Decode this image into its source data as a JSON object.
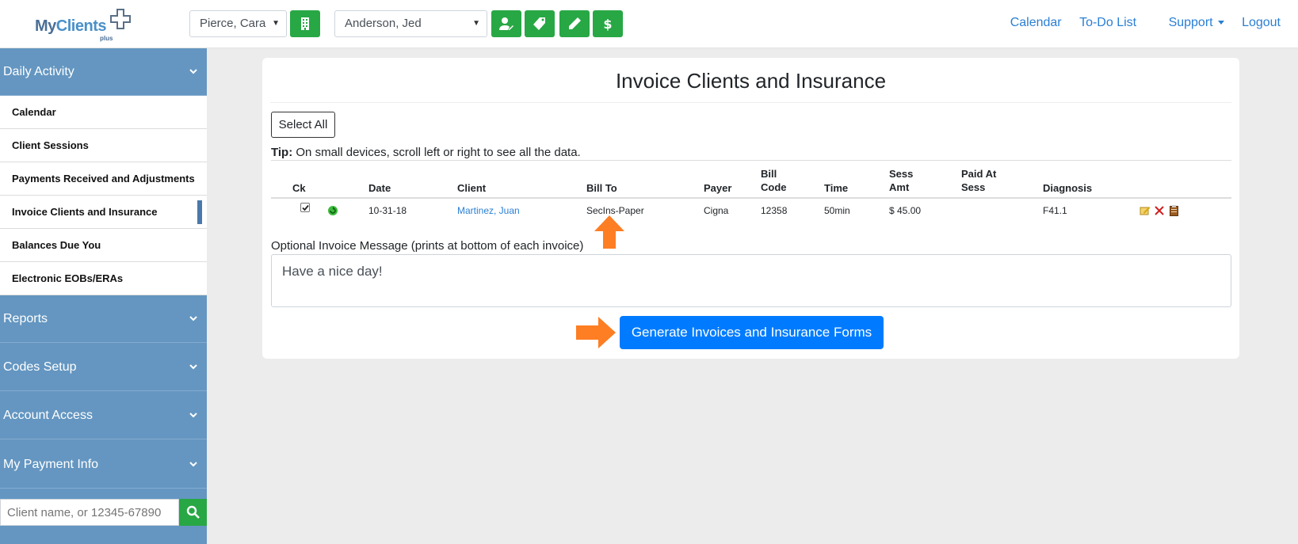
{
  "header": {
    "logo_text_my": "My",
    "logo_text_clients": "Clients",
    "logo_sub": "plus",
    "provider_select": "Pierce, Cara",
    "client_select": "Anderson, Jed",
    "nav": {
      "calendar": "Calendar",
      "todo": "To-Do List",
      "support": "Support",
      "logout": "Logout"
    }
  },
  "sidebar": {
    "sections": {
      "daily_activity": "Daily Activity",
      "reports": "Reports",
      "codes_setup": "Codes Setup",
      "account_access": "Account Access",
      "my_payment_info": "My Payment Info"
    },
    "items": [
      "Calendar",
      "Client Sessions",
      "Payments Received and Adjustments",
      "Invoice Clients and Insurance",
      "Balances Due You",
      "Electronic EOBs/ERAs"
    ],
    "active_item": "Invoice Clients and Insurance",
    "search_placeholder": "Client name, or 12345-67890"
  },
  "main": {
    "title": "Invoice Clients and Insurance",
    "select_all": "Select All",
    "tip_label": "Tip:",
    "tip_text": "On small devices, scroll left or right to see all the data.",
    "columns": {
      "ck": "Ck",
      "date": "Date",
      "client": "Client",
      "bill_to": "Bill To",
      "payer": "Payer",
      "bill_code_1": "Bill",
      "bill_code_2": "Code",
      "time": "Time",
      "sess_amt_1": "Sess",
      "sess_amt_2": "Amt",
      "paid_1": "Paid At",
      "paid_2": "Sess",
      "diagnosis": "Diagnosis"
    },
    "rows": [
      {
        "checked": true,
        "date": "10-31-18",
        "client": "Martinez, Juan",
        "bill_to": "SecIns-Paper",
        "payer": "Cigna",
        "bill_code": "12358",
        "time": "50min",
        "sess_amt": "$ 45.00",
        "paid_at_sess": "",
        "diagnosis": "F41.1"
      }
    ],
    "message_label": "Optional Invoice Message (prints at bottom of each invoice)",
    "message_value": "Have a nice day!",
    "generate_button": "Generate Invoices and Insurance Forms"
  },
  "colors": {
    "sidebar": "#6496c1",
    "green": "#28a745",
    "primary": "#007bff",
    "link": "#2a7fd4",
    "arrow": "#fd7e23"
  },
  "icons": [
    "building-icon",
    "user-edit-icon",
    "tag-icon",
    "pencil-icon",
    "dollar-icon",
    "search-icon",
    "refresh-icon",
    "edit-note-icon",
    "delete-icon",
    "clipboard-icon",
    "chevron-down-icon"
  ]
}
